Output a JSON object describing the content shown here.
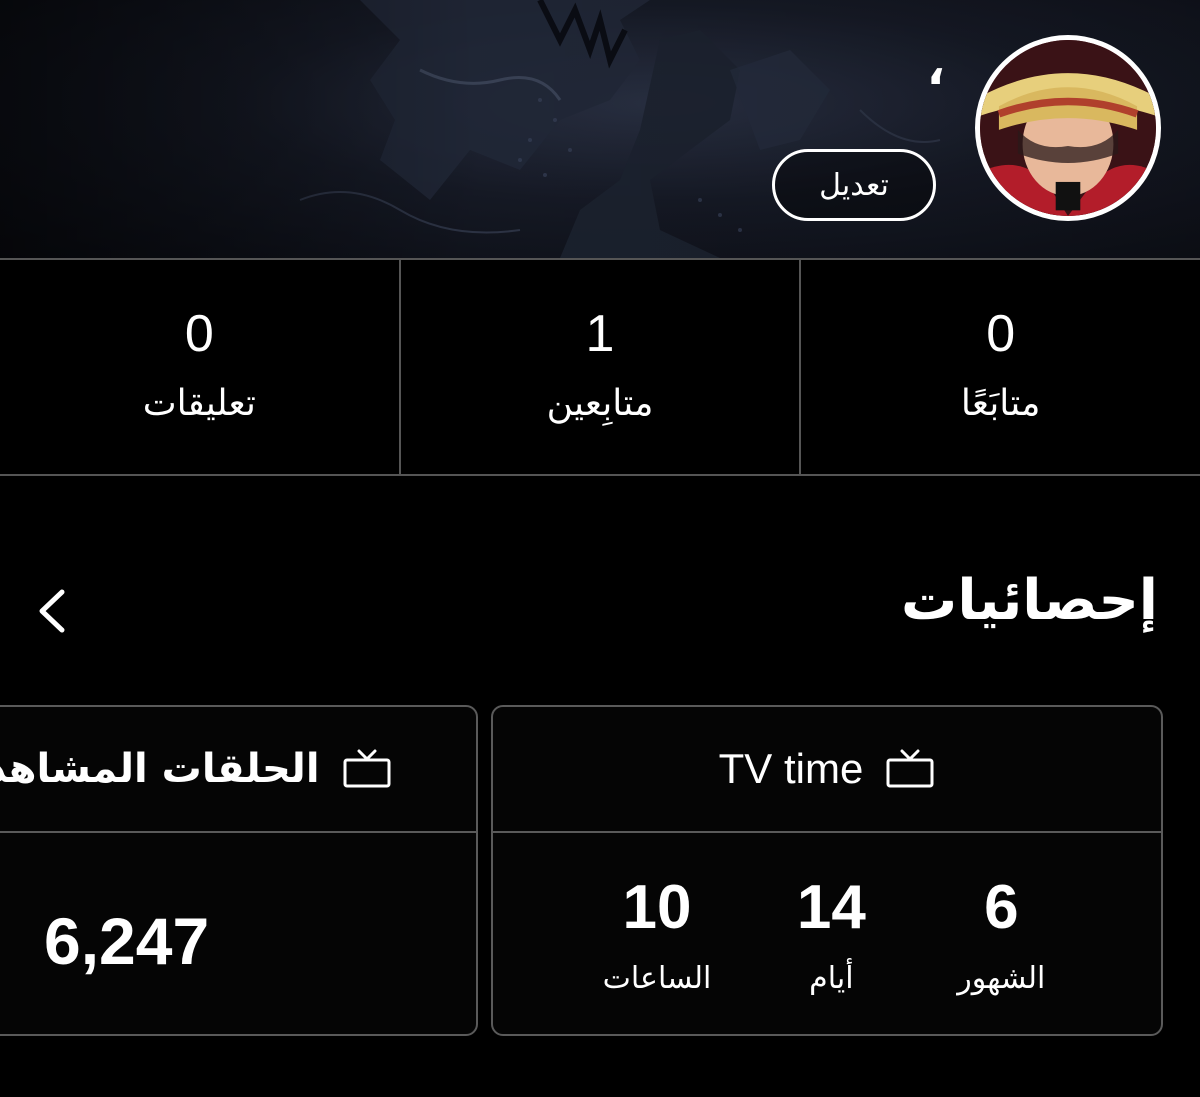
{
  "profile": {
    "username": "،",
    "edit_label": "تعديل"
  },
  "counters": [
    {
      "value": "0",
      "label": "متابَعًا"
    },
    {
      "value": "1",
      "label": "متابِعين"
    },
    {
      "value": "0",
      "label": "تعليقات"
    }
  ],
  "stats": {
    "title": "إحصائيات",
    "tv_time": {
      "title": "TV time",
      "items": [
        {
          "value": "6",
          "label": "الشهور"
        },
        {
          "value": "14",
          "label": "أيام"
        },
        {
          "value": "10",
          "label": "الساعات"
        }
      ]
    },
    "episodes": {
      "title": "الحلقات المشاهدة",
      "value": "6,247"
    }
  },
  "icons": {
    "chevron": "chevron-left-icon",
    "tv": "tv-icon",
    "avatar": "avatar-image"
  },
  "colors": {
    "background": "#000000",
    "divider": "#555555",
    "text": "#ffffff"
  }
}
